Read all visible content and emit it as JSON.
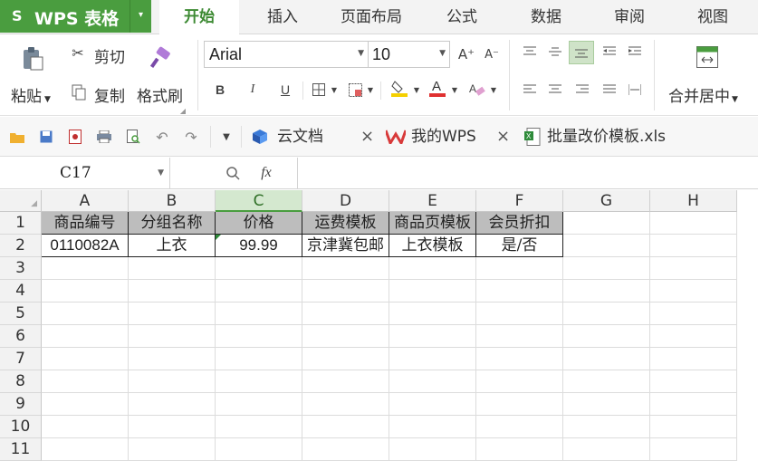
{
  "app": {
    "s_glyph": "S",
    "title": "WPS 表格",
    "menu_arrow": "▾"
  },
  "menu_tabs": [
    "开始",
    "插入",
    "页面布局",
    "公式",
    "数据",
    "审阅",
    "视图"
  ],
  "ribbon": {
    "paste": "粘贴",
    "cut": "剪切",
    "copy": "复制",
    "format_painter": "格式刷",
    "font_name": "Arial",
    "font_size": "10",
    "grow_font": "A⁺",
    "shrink_font": "A⁻",
    "bold": "B",
    "italic": "I",
    "underline": "U",
    "merge_center": "合并居中",
    "font_color": "#e03030",
    "fill_color": "#f5d000"
  },
  "quick_tabs": [
    {
      "label": "云文档",
      "close": "×"
    },
    {
      "label": "我的WPS",
      "close": "×"
    },
    {
      "label": "批量改价模板.xls"
    }
  ],
  "formula_bar": {
    "cell_ref": "C17",
    "fx": "fx"
  },
  "columns": [
    "A",
    "B",
    "C",
    "D",
    "E",
    "F",
    "G",
    "H"
  ],
  "rows": [
    "1",
    "2",
    "3",
    "4",
    "5",
    "6",
    "7",
    "8",
    "9",
    "10",
    "11"
  ],
  "sheet": {
    "header_row": [
      "商品编号",
      "分组名称",
      "价格",
      "运费模板",
      "商品页模板",
      "会员折扣"
    ],
    "data_row": [
      "0110082A",
      "上衣",
      "99.99",
      "京津冀包邮",
      "上衣模板",
      "是/否"
    ]
  }
}
